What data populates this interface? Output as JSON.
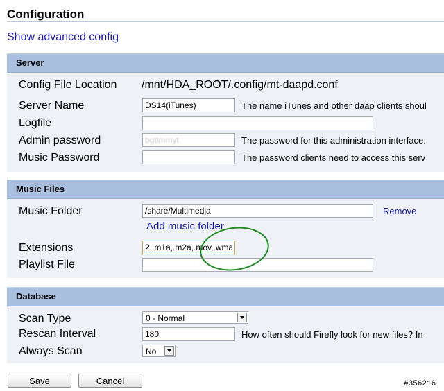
{
  "page": {
    "title": "Configuration",
    "advanced_link": "Show advanced config"
  },
  "server": {
    "header": "Server",
    "config_location_label": "Config File Location",
    "config_location_value": "/mnt/HDA_ROOT/.config/mt-daapd.conf",
    "server_name_label": "Server Name",
    "server_name_value": "DS14(iTunes)",
    "server_name_desc": "The name iTunes and other daap clients shoul",
    "logfile_label": "Logfile",
    "logfile_value": "",
    "admin_password_label": "Admin password",
    "admin_password_value": "bgtlmmyt",
    "admin_password_desc": "The password for this administration interface.",
    "music_password_label": "Music Password",
    "music_password_value": "",
    "music_password_desc": "The password clients need to access this serv"
  },
  "music_files": {
    "header": "Music Files",
    "music_folder_label": "Music Folder",
    "music_folder_value": "/share/Multimedia",
    "remove_link": "Remove",
    "add_folder_link": "Add music folder",
    "extensions_label": "Extensions",
    "extensions_value": "2,.m1a,.m2a,.mov,.wma",
    "playlist_label": "Playlist File",
    "playlist_value": ""
  },
  "database": {
    "header": "Database",
    "scan_type_label": "Scan Type",
    "scan_type_value": "0 - Normal",
    "rescan_label": "Rescan Interval",
    "rescan_value": "180",
    "rescan_desc": "How often should Firefly look for new files? In",
    "always_scan_label": "Always Scan",
    "always_scan_value": "No"
  },
  "buttons": {
    "save": "Save",
    "cancel": "Cancel"
  },
  "watermark": "#356216",
  "colors": {
    "header_bg": "#a9bfe0",
    "section_bg": "#eef2f7",
    "link": "#1a1aa6",
    "highlight_circle": "#1f8a1f"
  }
}
